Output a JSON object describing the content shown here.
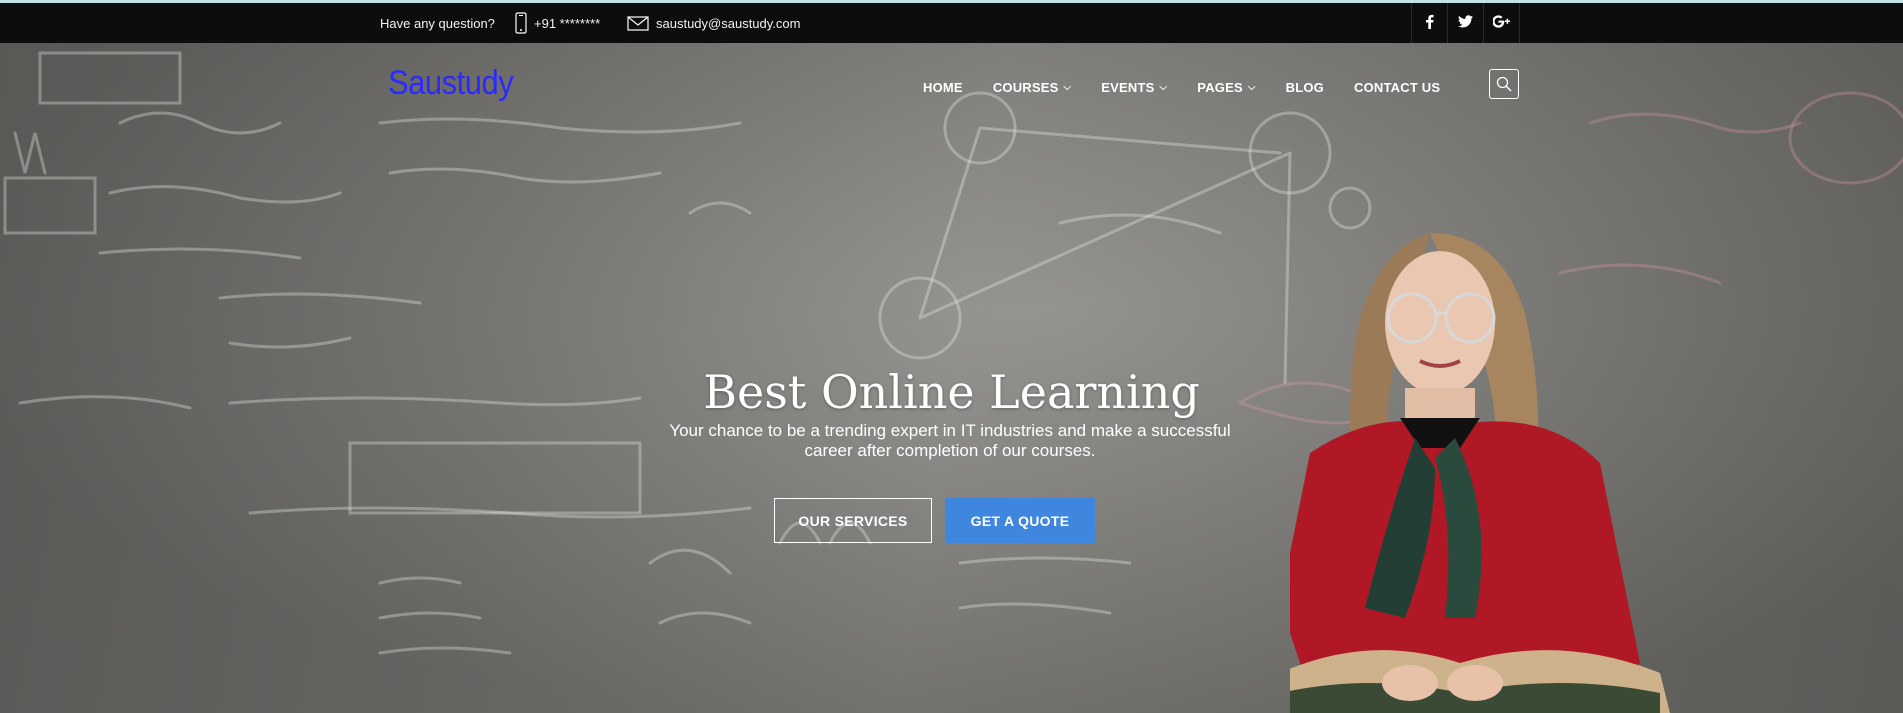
{
  "topbar": {
    "question": "Have any question?",
    "phone": "+91 ********",
    "email": "saustudy@saustudy.com",
    "social": [
      {
        "icon": "facebook-icon",
        "glyph": "f"
      },
      {
        "icon": "twitter-icon",
        "glyph": "t"
      },
      {
        "icon": "google-plus-icon",
        "glyph": "g+"
      }
    ]
  },
  "brand": {
    "logo": "Saustudy"
  },
  "nav": {
    "home": "HOME",
    "courses": "COURSES",
    "events": "EVENTS",
    "pages": "PAGES",
    "blog": "BLOG",
    "contact": "CONTACT US"
  },
  "hero": {
    "title": "Best Online Learning",
    "subtitle": "Your chance to be a trending expert in IT industries and make a successful career after completion of our courses.",
    "btn_services": "OUR SERVICES",
    "btn_quote": "GET A QUOTE"
  },
  "colors": {
    "accent": "#3f86df",
    "logo": "#2a2aff",
    "topbar": "#0d0d0d"
  }
}
